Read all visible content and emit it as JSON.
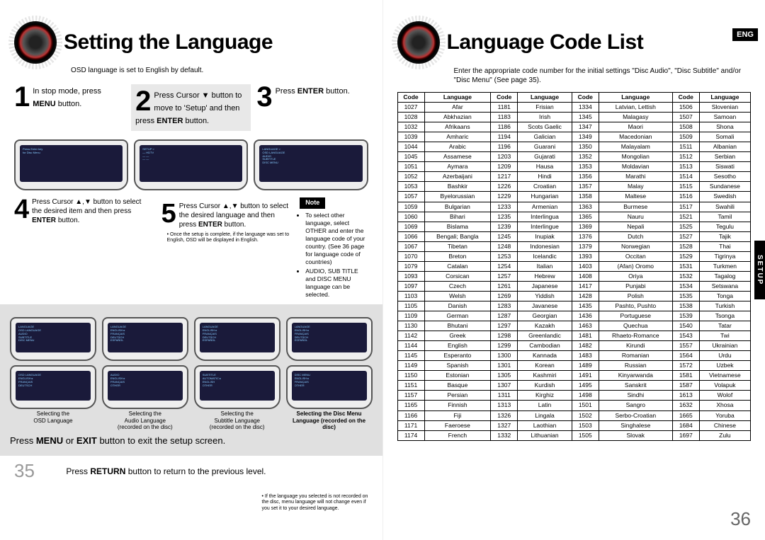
{
  "left": {
    "title": "Setting the Language",
    "subtitle": "OSD language is set to English by default.",
    "steps": [
      {
        "num": "1",
        "html": "In stop mode, press <b>MENU</b> button."
      },
      {
        "num": "2",
        "html": "Press Cursor ▼ button to move to 'Setup' and then press <b>ENTER</b> button."
      },
      {
        "num": "3",
        "html": "Press <b>ENTER</b> button."
      }
    ],
    "steps_mid": [
      {
        "num": "4",
        "html": "Press Cursor ▲,▼ button to select the desired item and then press <b>ENTER</b> button."
      },
      {
        "num": "5",
        "html": "Press Cursor ▲,▼ button to select the desired language and then press <b>ENTER</b> button."
      }
    ],
    "note_badge": "Note",
    "notes": [
      "To select other language, select OTHER and enter the language code of your country. (See 36 page for language code of countries)",
      "AUDIO, SUB TITLE and DISC MENU language can be selected."
    ],
    "tiny_note": "• Once the setup is complete, if the language was set to English, OSD will be displayed in English.",
    "captions": [
      "Selecting the\nOSD Language",
      "Selecting the\nAudio Language\n(recorded on the disc)",
      "Selecting the\nSubtitle Language\n(recorded on the disc)",
      "Selecting the Disc Menu\nLanguage (recorded on the disc)"
    ],
    "exit": "Press <b>MENU</b> or <b>EXIT</b> button to exit the setup screen.",
    "return": "Press <b>RETURN</b> button to return to the previous level.",
    "footnote": "• If the language you selected is not recorded on the disc, menu language will not change even if you set it to your desired language.",
    "page": "35"
  },
  "right": {
    "title": "Language Code List",
    "eng": "ENG",
    "setup_tab": "SETUP",
    "sub": "Enter the appropriate code number for the initial settings \"Disc Audio\", \"Disc Subtitle\" and/or \"Disc Menu\" (See page 35).",
    "headers": [
      "Code",
      "Language",
      "Code",
      "Language",
      "Code",
      "Language",
      "Code",
      "Language"
    ],
    "rows": [
      [
        "1027",
        "Afar",
        "1181",
        "Frisian",
        "1334",
        "Latvian, Lettish",
        "1506",
        "Slovenian"
      ],
      [
        "1028",
        "Abkhazian",
        "1183",
        "Irish",
        "1345",
        "Malagasy",
        "1507",
        "Samoan"
      ],
      [
        "1032",
        "Afrikaans",
        "1186",
        "Scots Gaelic",
        "1347",
        "Maori",
        "1508",
        "Shona"
      ],
      [
        "1039",
        "Amharic",
        "1194",
        "Galician",
        "1349",
        "Macedonian",
        "1509",
        "Somali"
      ],
      [
        "1044",
        "Arabic",
        "1196",
        "Guarani",
        "1350",
        "Malayalam",
        "1511",
        "Albanian"
      ],
      [
        "1045",
        "Assamese",
        "1203",
        "Gujarati",
        "1352",
        "Mongolian",
        "1512",
        "Serbian"
      ],
      [
        "1051",
        "Aymara",
        "1209",
        "Hausa",
        "1353",
        "Moldavian",
        "1513",
        "Siswati"
      ],
      [
        "1052",
        "Azerbaijani",
        "1217",
        "Hindi",
        "1356",
        "Marathi",
        "1514",
        "Sesotho"
      ],
      [
        "1053",
        "Bashkir",
        "1226",
        "Croatian",
        "1357",
        "Malay",
        "1515",
        "Sundanese"
      ],
      [
        "1057",
        "Byelorussian",
        "1229",
        "Hungarian",
        "1358",
        "Maltese",
        "1516",
        "Swedish"
      ],
      [
        "1059",
        "Bulgarian",
        "1233",
        "Armenian",
        "1363",
        "Burmese",
        "1517",
        "Swahili"
      ],
      [
        "1060",
        "Bihari",
        "1235",
        "Interlingua",
        "1365",
        "Nauru",
        "1521",
        "Tamil"
      ],
      [
        "1069",
        "Bislama",
        "1239",
        "Interlingue",
        "1369",
        "Nepali",
        "1525",
        "Tegulu"
      ],
      [
        "1066",
        "Bengali; Bangla",
        "1245",
        "Inupiak",
        "1376",
        "Dutch",
        "1527",
        "Tajik"
      ],
      [
        "1067",
        "Tibetan",
        "1248",
        "Indonesian",
        "1379",
        "Norwegian",
        "1528",
        "Thai"
      ],
      [
        "1070",
        "Breton",
        "1253",
        "Icelandic",
        "1393",
        "Occitan",
        "1529",
        "Tigrinya"
      ],
      [
        "1079",
        "Catalan",
        "1254",
        "Italian",
        "1403",
        "(Afan) Oromo",
        "1531",
        "Turkmen"
      ],
      [
        "1093",
        "Corsican",
        "1257",
        "Hebrew",
        "1408",
        "Oriya",
        "1532",
        "Tagalog"
      ],
      [
        "1097",
        "Czech",
        "1261",
        "Japanese",
        "1417",
        "Punjabi",
        "1534",
        "Setswana"
      ],
      [
        "1103",
        "Welsh",
        "1269",
        "Yiddish",
        "1428",
        "Polish",
        "1535",
        "Tonga"
      ],
      [
        "1105",
        "Danish",
        "1283",
        "Javanese",
        "1435",
        "Pashto, Pushto",
        "1538",
        "Turkish"
      ],
      [
        "1109",
        "German",
        "1287",
        "Georgian",
        "1436",
        "Portuguese",
        "1539",
        "Tsonga"
      ],
      [
        "1130",
        "Bhutani",
        "1297",
        "Kazakh",
        "1463",
        "Quechua",
        "1540",
        "Tatar"
      ],
      [
        "1142",
        "Greek",
        "1298",
        "Greenlandic",
        "1481",
        "Rhaeto-Romance",
        "1543",
        "Twi"
      ],
      [
        "1144",
        "English",
        "1299",
        "Cambodian",
        "1482",
        "Kirundi",
        "1557",
        "Ukrainian"
      ],
      [
        "1145",
        "Esperanto",
        "1300",
        "Kannada",
        "1483",
        "Romanian",
        "1564",
        "Urdu"
      ],
      [
        "1149",
        "Spanish",
        "1301",
        "Korean",
        "1489",
        "Russian",
        "1572",
        "Uzbek"
      ],
      [
        "1150",
        "Estonian",
        "1305",
        "Kashmiri",
        "1491",
        "Kinyarwanda",
        "1581",
        "Vietnamese"
      ],
      [
        "1151",
        "Basque",
        "1307",
        "Kurdish",
        "1495",
        "Sanskrit",
        "1587",
        "Volapuk"
      ],
      [
        "1157",
        "Persian",
        "1311",
        "Kirghiz",
        "1498",
        "Sindhi",
        "1613",
        "Wolof"
      ],
      [
        "1165",
        "Finnish",
        "1313",
        "Latin",
        "1501",
        "Sangro",
        "1632",
        "Xhosa"
      ],
      [
        "1166",
        "Fiji",
        "1326",
        "Lingala",
        "1502",
        "Serbo-Croatian",
        "1665",
        "Yoruba"
      ],
      [
        "1171",
        "Faeroese",
        "1327",
        "Laothian",
        "1503",
        "Singhalese",
        "1684",
        "Chinese"
      ],
      [
        "1174",
        "French",
        "1332",
        "Lithuanian",
        "1505",
        "Slovak",
        "1697",
        "Zulu"
      ]
    ],
    "page": "36"
  }
}
